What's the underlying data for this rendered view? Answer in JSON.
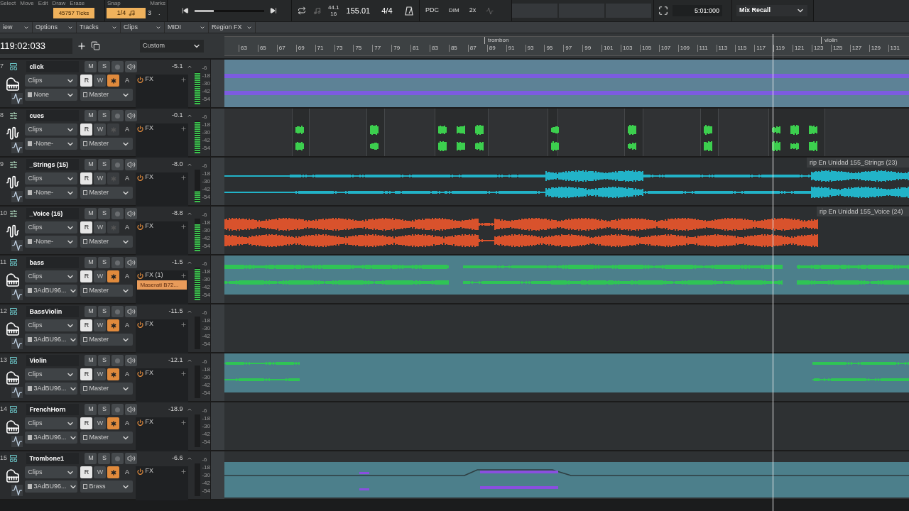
{
  "toolbar": {
    "tool_labels": [
      "Select",
      "Move",
      "Edit",
      "Draw",
      "Erase"
    ],
    "ticks": "45757 Ticks",
    "snap_label": "Snap",
    "snap": "1/4",
    "snap_count": "3",
    "snap_dot": ".",
    "marks_label": "Marks",
    "transport": {
      "level": 0.28
    },
    "sample_rate": "44.1",
    "bit_depth": "16",
    "tempo": "155.01",
    "meter": "4/4",
    "pdc": "PDC",
    "dim": "DIM",
    "speed": "2x",
    "end_time": "5:01:000",
    "mix_recall": "Mix Recall"
  },
  "menu": [
    "iew",
    "Options",
    "Tracks",
    "Clips",
    "MIDI",
    "Region FX"
  ],
  "position": "119:02:033",
  "view_preset": "Custom",
  "ruler": {
    "ticks": [
      "63",
      "65",
      "67",
      "69",
      "71",
      "73",
      "75",
      "77",
      "79",
      "81",
      "83",
      "85",
      "87",
      "89",
      "91",
      "93",
      "95",
      "97",
      "99",
      "101",
      "103",
      "105",
      "107",
      "109",
      "111",
      "113",
      "115",
      "117",
      "119",
      "121",
      "123",
      "125",
      "127",
      "129",
      "131"
    ],
    "markers": [
      "trombon",
      "violin"
    ]
  },
  "tracks": [
    {
      "number": "7",
      "name": "click",
      "kind": "instrument",
      "volume": "-5.1",
      "controls": [
        "M",
        "S",
        "R",
        "W",
        "A"
      ],
      "read": true,
      "echo": true,
      "clips": "Clips",
      "input": "None",
      "output": "Master",
      "fx": "FX",
      "meter": {
        "level": 0.95
      },
      "scale": [
        "-6",
        "-18",
        "-30",
        "-42",
        "-54"
      ],
      "lane": {
        "kind": "band",
        "color": "#7c5ce0"
      }
    },
    {
      "number": "8",
      "name": "cues",
      "kind": "audio",
      "volume": "-0.1",
      "controls": [
        "M",
        "S",
        "R",
        "W",
        "A"
      ],
      "read": true,
      "echo": false,
      "clips": "Clips",
      "input": "-None-",
      "output": "Master",
      "fx": "FX",
      "meter": {
        "level": 0.95
      },
      "scale": [
        "-6",
        "-18",
        "-30",
        "-42",
        "-54"
      ],
      "lane": {
        "kind": "cues",
        "color": "#3ccf4e"
      }
    },
    {
      "number": "9",
      "name": "_Strings (15)",
      "kind": "audio",
      "volume": "-8.0",
      "controls": [
        "M",
        "S",
        "R",
        "W",
        "A"
      ],
      "read": true,
      "echo": false,
      "clips": "Clips",
      "input": "-None-",
      "output": "Master",
      "fx": "FX",
      "meter": {
        "level": 0.35
      },
      "scale": [
        "-6",
        "-18",
        "-30",
        "-42",
        "-54"
      ],
      "lane": {
        "kind": "wave",
        "color": "#22b3c8",
        "label": "rip En Unidad 155_Strings (23)"
      }
    },
    {
      "number": "10",
      "name": "_Voice (16)",
      "kind": "audio",
      "volume": "-8.8",
      "controls": [
        "M",
        "S",
        "R",
        "W",
        "A"
      ],
      "read": true,
      "echo": false,
      "clips": "Clips",
      "input": "-None-",
      "output": "Master",
      "fx": "FX",
      "meter": {
        "level": 0.85
      },
      "scale": [
        "-6",
        "-18",
        "-30",
        "-42",
        "-54"
      ],
      "lane": {
        "kind": "loud",
        "color": "#d9522c",
        "label": "rip En Unidad 155_Voice (24)"
      }
    },
    {
      "number": "11",
      "name": "bass",
      "kind": "instrument",
      "volume": "-1.5",
      "controls": [
        "M",
        "S",
        "R",
        "W",
        "A"
      ],
      "read": true,
      "echo": true,
      "clips": "Clips",
      "input": "3AdBU96...",
      "output": "Master",
      "fx": "FX (1)",
      "plugin": "Maserati B72...",
      "meter": {
        "level": 0.95
      },
      "scale": [
        "-6",
        "-18",
        "-30",
        "-42",
        "-54"
      ],
      "lane": {
        "kind": "midi",
        "color": "#2fc455"
      }
    },
    {
      "number": "12",
      "name": "BassViolin",
      "kind": "instrument",
      "volume": "-11.5",
      "controls": [
        "M",
        "S",
        "R",
        "W",
        "A"
      ],
      "read": true,
      "echo": true,
      "clips": "Clips",
      "input": "3AdBU96...",
      "output": "Master",
      "fx": "FX",
      "scale": [
        "-6",
        "-18",
        "-30",
        "-42",
        "-54"
      ]
    },
    {
      "number": "13",
      "name": "Violin",
      "kind": "instrument",
      "volume": "-12.1",
      "controls": [
        "M",
        "S",
        "R",
        "W",
        "A"
      ],
      "read": true,
      "echo": true,
      "clips": "Clips",
      "input": "3AdBU96...",
      "output": "Master",
      "fx": "FX",
      "scale": [
        "-6",
        "-18",
        "-30",
        "-42",
        "-54"
      ],
      "lane": {
        "kind": "sparse",
        "color": "#2fc455"
      }
    },
    {
      "number": "14",
      "name": "FrenchHorn",
      "kind": "instrument",
      "volume": "-18.9",
      "controls": [
        "M",
        "S",
        "R",
        "W",
        "A"
      ],
      "read": true,
      "echo": true,
      "clips": "Clips",
      "input": "3AdBU96...",
      "output": "Master",
      "fx": "FX",
      "scale": [
        "-6",
        "-18",
        "-30",
        "-42",
        "-54"
      ]
    },
    {
      "number": "15",
      "name": "Trombone1",
      "kind": "instrument",
      "volume": "-6.6",
      "controls": [
        "M",
        "S",
        "R",
        "W",
        "A"
      ],
      "read": true,
      "echo": true,
      "clips": "Clips",
      "input": "3AdBU96...",
      "output": "Brass",
      "fx": "FX",
      "scale": [
        "-6",
        "-18",
        "-30",
        "-42",
        "-54"
      ],
      "lane": {
        "kind": "automation",
        "color": "#8a4fe0"
      }
    }
  ]
}
